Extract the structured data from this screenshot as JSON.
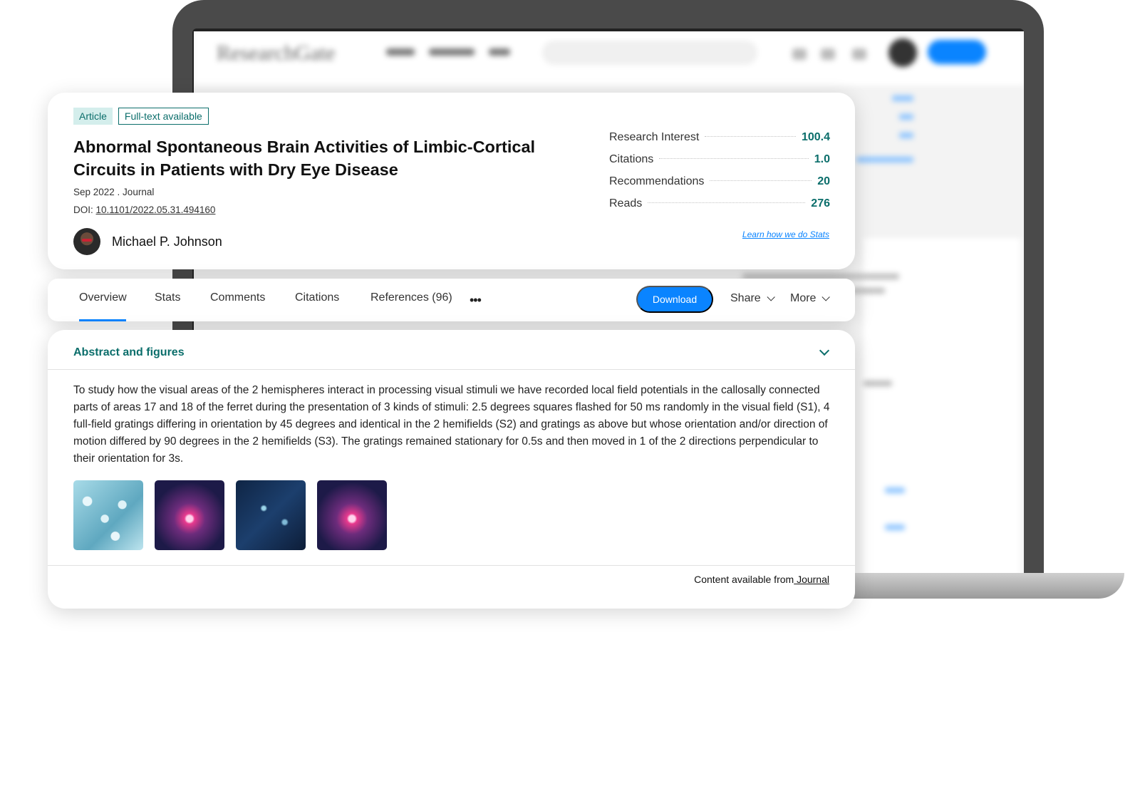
{
  "background": {
    "logo_text": "ResearchGate"
  },
  "article": {
    "badge_type": "Article",
    "badge_fulltext": "Full-text available",
    "title": "Abnormal Spontaneous Brain Activities of Limbic-Cortical Circuits in Patients with Dry Eye Disease",
    "date_journal": "Sep 2022 . Journal",
    "doi_prefix": "DOI: ",
    "doi": "10.1101/2022.05.31.494160",
    "author": "Michael P. Johnson"
  },
  "stats": {
    "rows": [
      {
        "label": "Research Interest",
        "value": "100.4"
      },
      {
        "label": "Citations",
        "value": "1.0"
      },
      {
        "label": "Recommendations",
        "value": "20"
      },
      {
        "label": "Reads",
        "value": "276"
      }
    ],
    "link": "Learn how we do Stats"
  },
  "tabs": {
    "items": [
      "Overview",
      "Stats",
      "Comments",
      "Citations",
      "References (96)"
    ],
    "active": "Overview",
    "more_dots": "•••",
    "download": "Download",
    "share": "Share",
    "more": "More"
  },
  "abstract": {
    "heading": "Abstract and figures",
    "text": "To study how the visual areas of the 2 hemispheres interact in processing visual stimuli we have recorded local field potentials in the callosally connected parts of areas 17 and 18 of the ferret during the presentation of 3 kinds of stimuli: 2.5 degrees squares flashed for 50 ms randomly in the visual field (S1), 4 full-field gratings differing in orientation by 45 degrees and identical in the 2 hemifields (S2) and gratings as above but whose orientation and/or direction of motion differed by 90 degrees in the 2 hemifields (S3). The gratings remained stationary for 0.5s and then moved in 1 of the 2 directions perpendicular to their orientation for 3s.",
    "figures": [
      "molecule",
      "neuron",
      "neural-network",
      "neuron"
    ],
    "content_from_prefix": "Content available from",
    "content_from_link": " Journal"
  },
  "colors": {
    "accent": "#0a84ff",
    "teal": "#0b6e6b"
  }
}
